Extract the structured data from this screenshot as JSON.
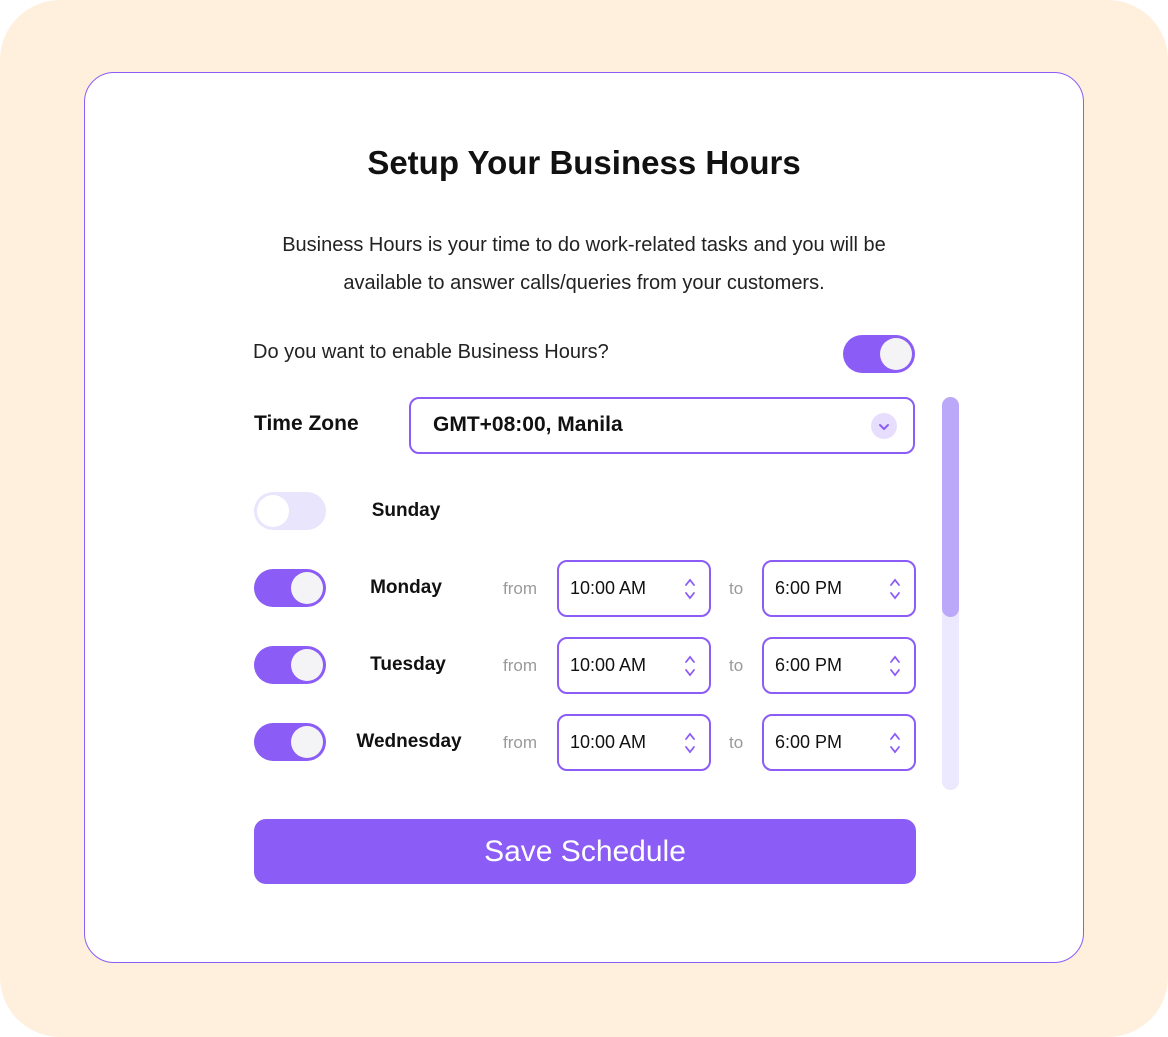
{
  "header": {
    "title": "Setup Your Business Hours",
    "description": "Business Hours is your time to do work-related tasks and you will be available to answer calls/queries from your customers."
  },
  "enable": {
    "label": "Do you want to enable Business Hours?",
    "enabled": true
  },
  "timezone": {
    "label": "Time Zone",
    "value": "GMT+08:00, Manila",
    "icon": "chevron-down-icon"
  },
  "days": [
    {
      "name": "Sunday",
      "enabled": false
    },
    {
      "name": "Monday",
      "enabled": true,
      "from_label": "from",
      "from": "10:00 AM",
      "to_label": "to",
      "to": "6:00 PM"
    },
    {
      "name": "Tuesday",
      "enabled": true,
      "from_label": "from",
      "from": "10:00 AM",
      "to_label": "to",
      "to": "6:00 PM"
    },
    {
      "name": "Wednesday",
      "enabled": true,
      "from_label": "from",
      "from": "10:00 AM",
      "to_label": "to",
      "to": "6:00 PM"
    }
  ],
  "actions": {
    "save_label": "Save Schedule"
  },
  "colors": {
    "accent": "#8b5cf6",
    "accent_light": "#e9e5fc",
    "background": "#fff0dd"
  }
}
